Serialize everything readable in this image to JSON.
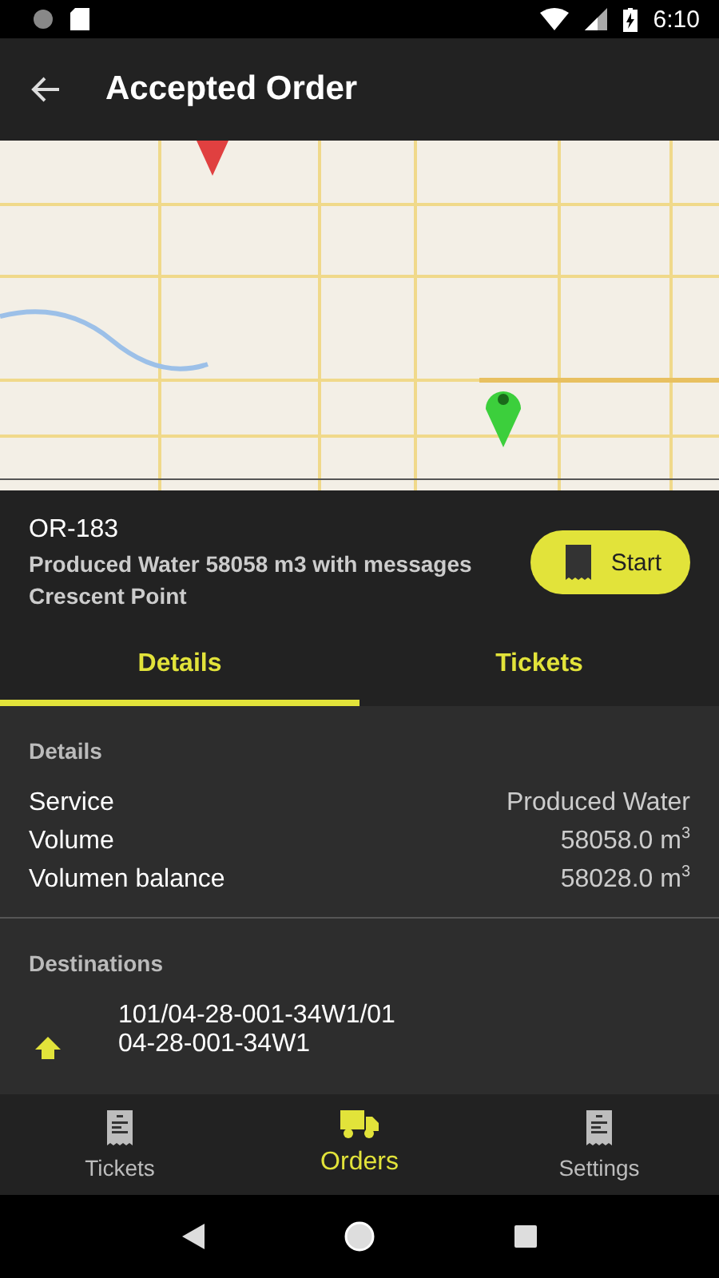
{
  "status_bar": {
    "time": "6:10"
  },
  "app_bar": {
    "title": "Accepted Order"
  },
  "order": {
    "id": "OR-183",
    "description": "Produced Water 58058 m3 with messages",
    "company": "Crescent Point",
    "start_button": "Start"
  },
  "tabs": [
    {
      "label": "Details",
      "selected": true
    },
    {
      "label": "Tickets",
      "selected": false
    }
  ],
  "details": {
    "heading": "Details",
    "rows": [
      {
        "label": "Service",
        "value": "Produced Water"
      },
      {
        "label": "Volume",
        "value": "58058.0 m$^{3}$"
      },
      {
        "label": "Volumen balance",
        "value": "58028.0 m$^{3}$"
      }
    ]
  },
  "destinations": {
    "heading": "Destinations",
    "items": [
      {
        "lines": [
          "101/04-28-001-34W1/01",
          "04-28-001-34W1"
        ]
      }
    ]
  },
  "bottom_nav": [
    {
      "label": "Tickets",
      "kind": "ticket",
      "selected": false
    },
    {
      "label": "Orders",
      "kind": "truck",
      "selected": true
    },
    {
      "label": "Settings",
      "kind": "ticket",
      "selected": false
    }
  ]
}
